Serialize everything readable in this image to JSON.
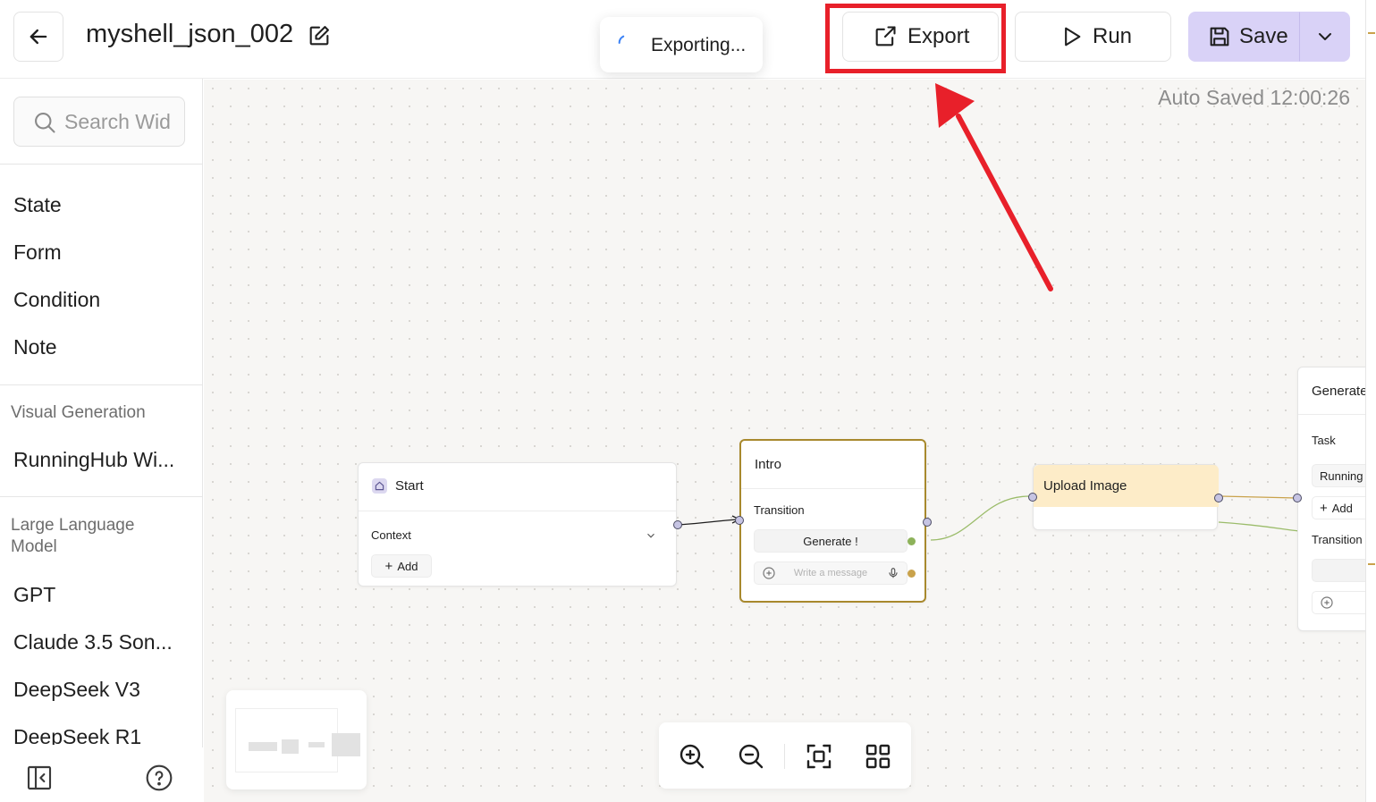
{
  "header": {
    "title": "myshell_json_002",
    "toast_text": "Exporting...",
    "export_label": "Export",
    "run_label": "Run",
    "save_label": "Save"
  },
  "sidebar": {
    "search_placeholder": "Search Wid",
    "items": [
      "State",
      "Form",
      "Condition",
      "Note"
    ],
    "visual_generation": {
      "category": "Visual Generation",
      "items": [
        "RunningHub Wi..."
      ]
    },
    "llm": {
      "category": "Large Language Model",
      "items": [
        "GPT",
        "Claude 3.5 Son...",
        "DeepSeek V3",
        "DeepSeek R1"
      ]
    }
  },
  "canvas": {
    "autosave": "Auto Saved 12:00:26",
    "nodes": {
      "start": {
        "title": "Start",
        "context_label": "Context",
        "add_label": "Add"
      },
      "intro": {
        "title": "Intro",
        "transition_label": "Transition",
        "button_label": "Generate !",
        "message_placeholder": "Write a message"
      },
      "upload": {
        "title": "Upload Image"
      },
      "generate": {
        "title": "Generate",
        "task_label": "Task",
        "task_value": "Running",
        "add_label": "Add",
        "transition_label": "Transition"
      }
    }
  },
  "colors": {
    "accent_purple": "#d9d2f7",
    "highlight_red": "#e8202a",
    "intro_border": "#a8892d",
    "upload_header": "#fdecc8"
  }
}
